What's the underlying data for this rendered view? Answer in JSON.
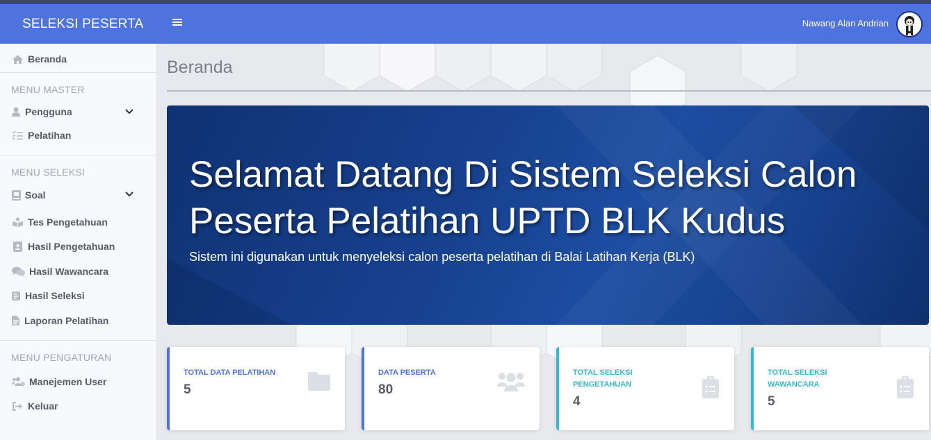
{
  "topbar": {
    "brand": "SELEKSI PESERTA",
    "menu_icon": "bars-icon",
    "user_name": "Nawang Alan Andrian",
    "color": "#4e73df"
  },
  "sidebar": {
    "home": {
      "label": "Beranda",
      "icon": "home-icon"
    },
    "master_heading": "MENU MASTER",
    "master_items": [
      {
        "label": "Pengguna",
        "icon": "user-icon",
        "expandable": true
      },
      {
        "label": "Pelatihan",
        "icon": "checklist-icon"
      }
    ],
    "seleksi_heading": "MENU SELEKSI",
    "seleksi_items": [
      {
        "label": "Soal",
        "icon": "book-icon",
        "expandable": true
      },
      {
        "label": "Tes Pengetahuan",
        "icon": "reader-icon"
      },
      {
        "label": "Hasil Pengetahuan",
        "icon": "id-card-icon"
      },
      {
        "label": "Hasil Wawancara",
        "icon": "comments-icon"
      },
      {
        "label": "Hasil Seleksi",
        "icon": "poll-icon"
      },
      {
        "label": "Laporan Pelatihan",
        "icon": "file-icon"
      }
    ],
    "pengaturan_heading": "MENU PENGATURAN",
    "pengaturan_items": [
      {
        "label": "Manejemen User",
        "icon": "users-cog-icon"
      },
      {
        "label": "Keluar",
        "icon": "sign-out-icon"
      }
    ]
  },
  "main": {
    "page_title": "Beranda",
    "hero": {
      "title": "Selamat Datang Di Sistem Seleksi Calon Peserta Pelatihan UPTD BLK Kudus",
      "subtitle": "Sistem ini digunakan untuk menyeleksi calon peserta pelatihan di Balai Latihan Kerja (BLK)"
    },
    "cards": [
      {
        "label": "Total Data Pelatihan",
        "value": "5",
        "icon": "folder-icon",
        "accent": "#4e73df"
      },
      {
        "label": "Data Peserta",
        "value": "80",
        "icon": "users-icon",
        "accent": "#4e73df"
      },
      {
        "label": "Total Seleksi Pengetahuan",
        "value": "4",
        "icon": "clipboard-list-icon",
        "accent": "#36b9cc"
      },
      {
        "label": "Total Seleksi Wawancara",
        "value": "5",
        "icon": "clipboard-list-icon",
        "accent": "#36b9cc"
      }
    ]
  }
}
